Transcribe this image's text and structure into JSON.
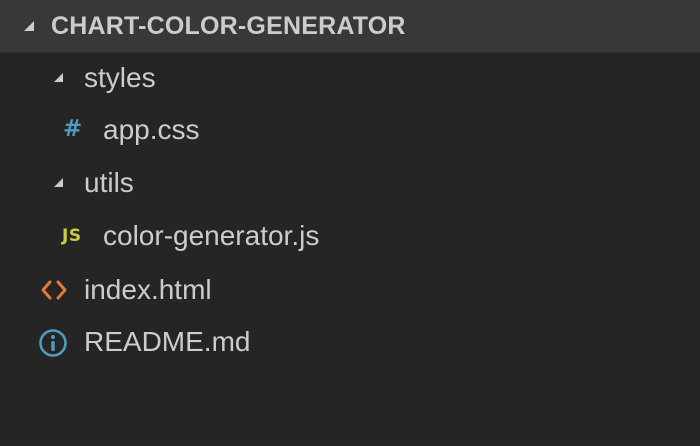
{
  "explorer": {
    "section_title": "CHART-COLOR-GENERATOR",
    "tree": [
      {
        "label": "styles",
        "type": "folder",
        "expanded": true,
        "icon": "chevron-down-icon"
      },
      {
        "label": "app.css",
        "type": "file",
        "icon": "css-hash-icon",
        "icon_glyph": "#",
        "icon_color": "#519aba"
      },
      {
        "label": "utils",
        "type": "folder",
        "expanded": true,
        "icon": "chevron-down-icon"
      },
      {
        "label": "color-generator.js",
        "type": "file",
        "icon": "js-icon",
        "icon_glyph": "JS",
        "icon_color": "#cbcb41"
      },
      {
        "label": "index.html",
        "type": "file",
        "icon": "html-code-icon",
        "icon_color": "#e37933"
      },
      {
        "label": "README.md",
        "type": "file",
        "icon": "info-icon",
        "icon_color": "#519aba"
      }
    ]
  },
  "colors": {
    "background": "#252526",
    "header_background": "#383838",
    "text": "#cccccc"
  }
}
